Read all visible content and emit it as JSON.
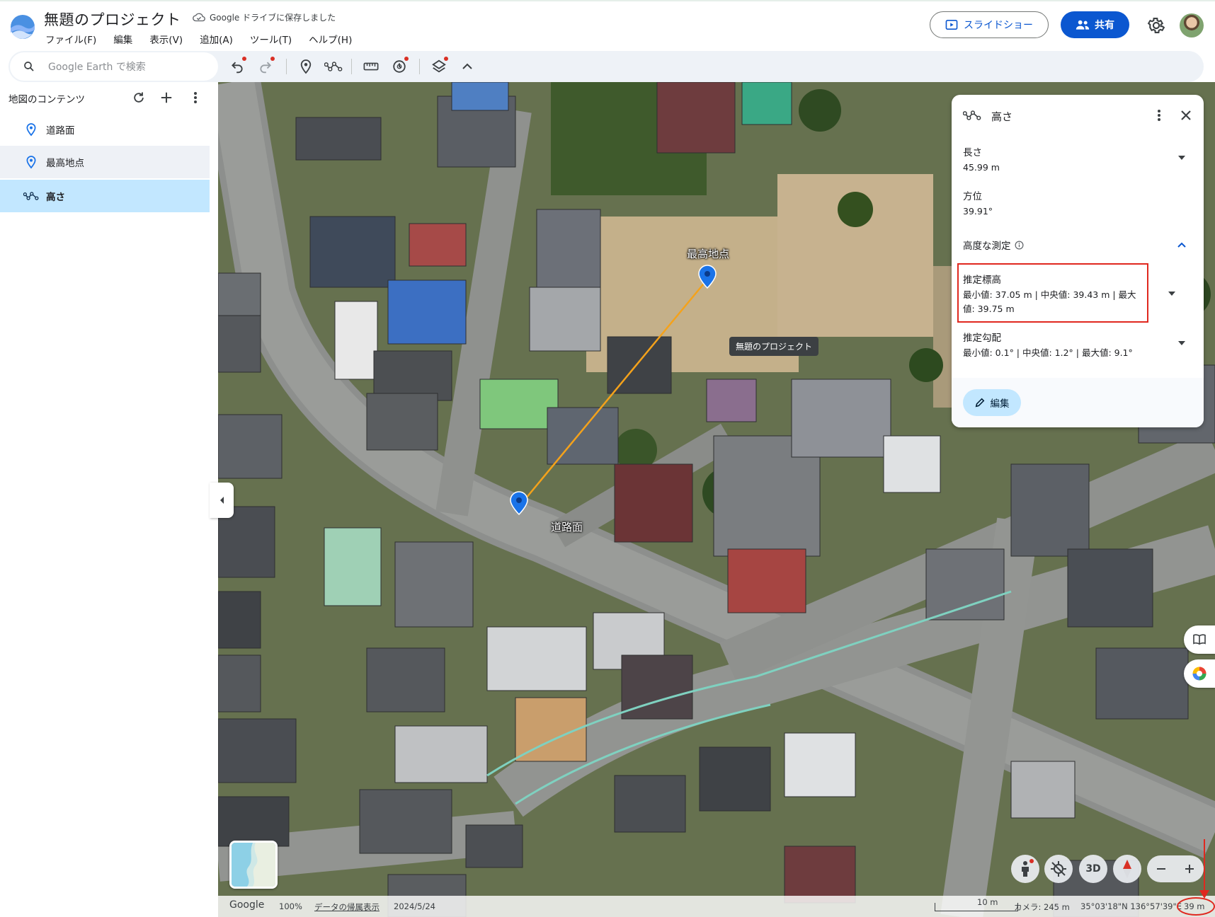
{
  "header": {
    "project_title": "無題のプロジェクト",
    "save_status": "Google ドライブに保存しました",
    "menu": [
      "ファイル(F)",
      "編集",
      "表示(V)",
      "追加(A)",
      "ツール(T)",
      "ヘルプ(H)"
    ],
    "slideshow_label": "スライドショー",
    "share_label": "共有"
  },
  "toolbar": {
    "search_placeholder": "Google Earth で検索"
  },
  "sidebar": {
    "title": "地図のコンテンツ",
    "items": [
      {
        "label": "道路面",
        "icon": "placemark-icon"
      },
      {
        "label": "最高地点",
        "icon": "placemark-icon"
      },
      {
        "label": "高さ",
        "icon": "path-icon"
      }
    ]
  },
  "map": {
    "labels": {
      "highest_point": "最高地点",
      "road_surface": "道路面",
      "tooltip": "無題のプロジェクト"
    }
  },
  "panel": {
    "title": "高さ",
    "length_label": "長さ",
    "length_value": "45.99 m",
    "bearing_label": "方位",
    "bearing_value": "39.91°",
    "advanced_label": "高度な測定",
    "elevation_label": "推定標高",
    "elevation_value": "最小値: 37.05 m | 中央値: 39.43 m | 最大値: 39.75 m",
    "slope_label": "推定勾配",
    "slope_value": "最小値: 0.1° | 中央値: 1.2° | 最大値: 9.1°",
    "edit_label": "編集"
  },
  "controls": {
    "three_d_label": "3D"
  },
  "status": {
    "brand": "Google",
    "zoom": "100%",
    "data_attribution": "データの帰属表示",
    "date": "2024/5/24",
    "scale": "10 m",
    "camera": "カメラ: 245 m",
    "coords": "35°03'18\"N 136°57'39\"E",
    "elevation": "39 m"
  },
  "colors": {
    "accent": "#0b57d0",
    "selected_bg": "#c2e7ff",
    "highlight_red": "#e0281f",
    "measure_line": "#f4a21b"
  }
}
